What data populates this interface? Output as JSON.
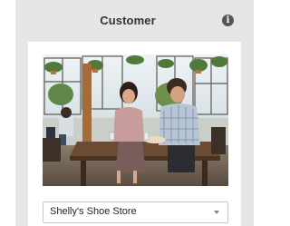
{
  "panel": {
    "title": "Customer",
    "info_icon": "info-icon",
    "image_icon": "customer-photo"
  },
  "customer_select": {
    "selected": "Shelly's Shoe Store",
    "icon": "chevron-down-icon"
  }
}
